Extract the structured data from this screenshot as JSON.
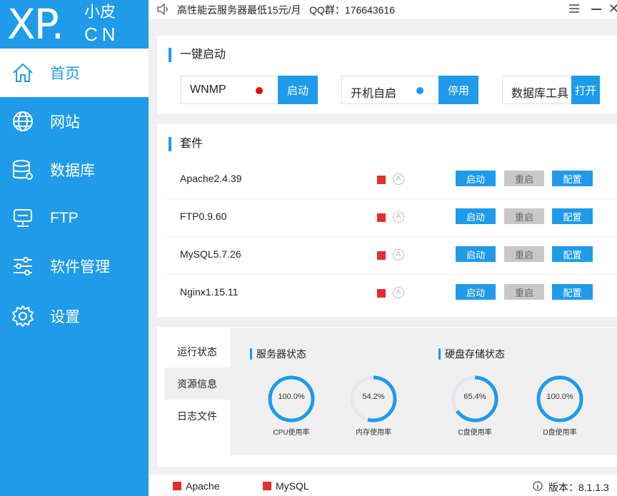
{
  "logo": {
    "big": "XP.",
    "small": "小皮",
    "cn": "CN"
  },
  "nav": [
    {
      "label": "首页",
      "icon": "home-icon"
    },
    {
      "label": "网站",
      "icon": "globe-icon"
    },
    {
      "label": "数据库",
      "icon": "database-icon"
    },
    {
      "label": "FTP",
      "icon": "server-icon"
    },
    {
      "label": "软件管理",
      "icon": "sliders-icon"
    },
    {
      "label": "设置",
      "icon": "gear-icon"
    }
  ],
  "topbar": {
    "message": "高性能云服务器最低15元/月   QQ群：176643616",
    "close": "✕"
  },
  "quick_start": {
    "title": "一键启动",
    "wnmp": {
      "label": "WNMP",
      "button": "启动",
      "dot_color": "#e01010"
    },
    "autostart": {
      "label": "开机自启",
      "button": "停用",
      "dot_color": "#1f9bea"
    },
    "dbtool": {
      "label": "数据库工具",
      "button": "打开"
    }
  },
  "suite": {
    "title": "套件",
    "icon_letter": "A",
    "rows": [
      {
        "name": "Apache2.4.39",
        "start": "启动",
        "restart": "重启",
        "config": "配置"
      },
      {
        "name": "FTP0.9.60",
        "start": "启动",
        "restart": "重启",
        "config": "配置"
      },
      {
        "name": "MySQL5.7.26",
        "start": "启动",
        "restart": "重启",
        "config": "配置"
      },
      {
        "name": "Nginx1.15.11",
        "start": "启动",
        "restart": "重启",
        "config": "配置"
      }
    ]
  },
  "tabs": [
    "运行状态",
    "资源信息",
    "日志文件"
  ],
  "server_status": {
    "title": "服务器状态",
    "gauges": [
      {
        "value": "100.0%",
        "fraction": 1.0,
        "label": "CPU使用率"
      },
      {
        "value": "54.2%",
        "fraction": 0.542,
        "label": "内存使用率"
      }
    ]
  },
  "disk_status": {
    "title": "硬盘存储状态",
    "gauges": [
      {
        "value": "65.4%",
        "fraction": 0.654,
        "label": "C盘使用率"
      },
      {
        "value": "100.0%",
        "fraction": 1.0,
        "label": "D盘使用率"
      }
    ]
  },
  "footer": {
    "apache": "Apache",
    "mysql": "MySQL",
    "version": "版本：8.1.1.3"
  },
  "colors": {
    "accent": "#1f9bea",
    "stopped": "#e03030",
    "gauge_track": "#e4e8ef"
  }
}
